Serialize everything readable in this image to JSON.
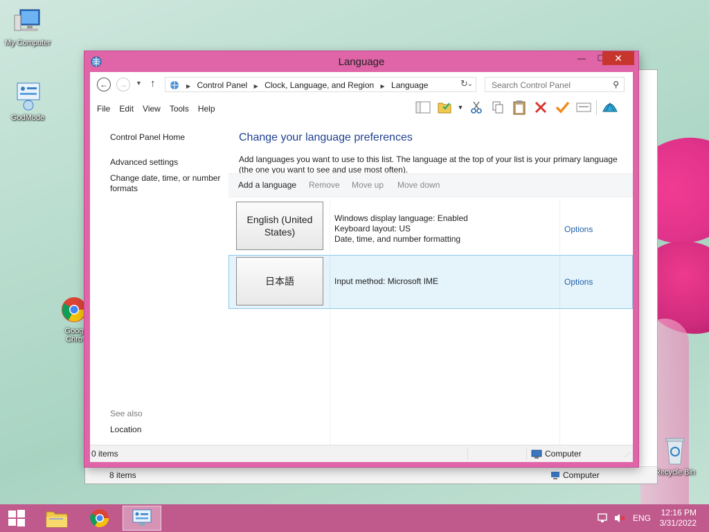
{
  "desktop": {
    "icons": [
      {
        "label": "My Computer"
      },
      {
        "label": "GodMode"
      },
      {
        "label": "Goog Chro"
      },
      {
        "label": "Recycle Bin"
      }
    ]
  },
  "background_window": {
    "status_items": "8 items",
    "status_location": "Computer"
  },
  "window": {
    "title": "Language",
    "controls": {
      "minimize": "—",
      "maximize": "☐",
      "close": "✕"
    },
    "address": {
      "breadcrumb": [
        "Control Panel",
        "Clock, Language, and Region",
        "Language"
      ],
      "search_placeholder": "Search Control Panel"
    },
    "menu": [
      "File",
      "Edit",
      "View",
      "Tools",
      "Help"
    ],
    "left_pane": {
      "home": "Control Panel Home",
      "links": [
        "Advanced settings",
        "Change date, time, or number formats"
      ],
      "see_also_label": "See also",
      "see_also_links": [
        "Location"
      ]
    },
    "main": {
      "heading": "Change your language preferences",
      "description": "Add languages you want to use to this list. The language at the top of your list is your primary language (the one you want to see and use most often).",
      "commands": {
        "add": "Add a language",
        "remove": "Remove",
        "move_up": "Move up",
        "move_down": "Move down"
      },
      "languages": [
        {
          "name": "English (United States)",
          "details": [
            "Windows display language: Enabled",
            "Keyboard layout: US",
            "Date, time, and number formatting"
          ],
          "options": "Options"
        },
        {
          "name": "日本語",
          "details": [
            "Input method: Microsoft IME"
          ],
          "options": "Options"
        }
      ]
    },
    "status": {
      "items": "0 items",
      "location": "Computer"
    }
  },
  "taskbar": {
    "language": "ENG",
    "time": "12:16 PM",
    "date": "3/31/2022"
  },
  "colors": {
    "window_frame": "#e064a8",
    "close_button": "#c7362c",
    "heading_blue": "#1e3f91",
    "link_blue": "#1e5fa8",
    "selected_row": "#e5f3fb",
    "taskbar": "#c05a8d"
  }
}
